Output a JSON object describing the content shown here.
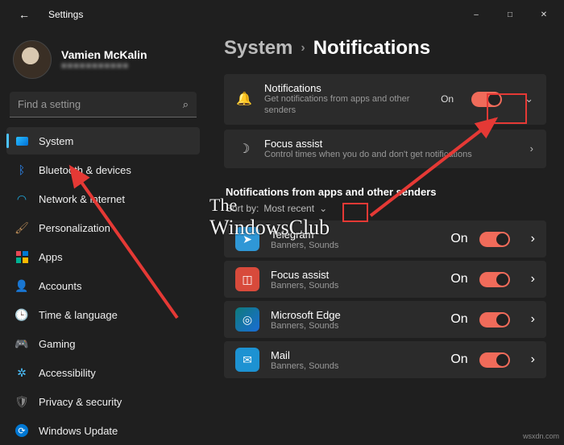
{
  "window": {
    "title": "Settings",
    "controls": {
      "minimize": "–",
      "maximize": "□",
      "close": "✕"
    }
  },
  "user": {
    "name": "Vamien McKalin",
    "email": "■■■■■■■■■■■"
  },
  "search": {
    "placeholder": "Find a setting"
  },
  "sidebar": {
    "items": [
      {
        "label": "System"
      },
      {
        "label": "Bluetooth & devices"
      },
      {
        "label": "Network & internet"
      },
      {
        "label": "Personalization"
      },
      {
        "label": "Apps"
      },
      {
        "label": "Accounts"
      },
      {
        "label": "Time & language"
      },
      {
        "label": "Gaming"
      },
      {
        "label": "Accessibility"
      },
      {
        "label": "Privacy & security"
      },
      {
        "label": "Windows Update"
      }
    ]
  },
  "breadcrumb": {
    "parent": "System",
    "sep": "›",
    "current": "Notifications"
  },
  "cards": {
    "notifications": {
      "title": "Notifications",
      "sub": "Get notifications from apps and other senders",
      "state": "On"
    },
    "focus": {
      "title": "Focus assist",
      "sub": "Control times when you do and don't get notifications"
    }
  },
  "section": {
    "heading": "Notifications from apps and other senders",
    "sort_label": "Sort by:",
    "sort_value": "Most recent"
  },
  "apps": [
    {
      "name": "Telegram",
      "sub": "Banners, Sounds",
      "state": "On",
      "bg": "#2f97d6",
      "glyph": "➤"
    },
    {
      "name": "Focus assist",
      "sub": "Banners, Sounds",
      "state": "On",
      "bg": "#d84a3b",
      "glyph": "◫"
    },
    {
      "name": "Microsoft Edge",
      "sub": "Banners, Sounds",
      "state": "On",
      "bg": "linear-gradient(135deg,#0f7b7b,#1a6dd6)",
      "glyph": "◎"
    },
    {
      "name": "Mail",
      "sub": "Banners, Sounds",
      "state": "On",
      "bg": "#1d92d2",
      "glyph": "✉"
    }
  ],
  "watermark": {
    "line1": "The",
    "line2": "WindowsClub"
  },
  "sitetag": "wsxdn.com"
}
